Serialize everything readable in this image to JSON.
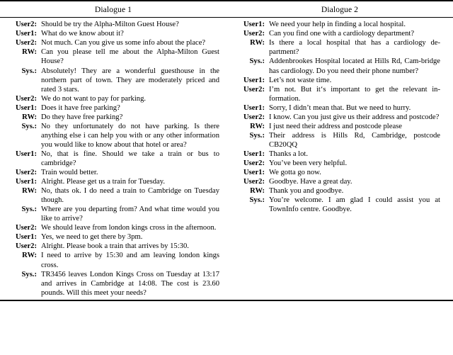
{
  "table": {
    "headers": [
      "Dialogue 1",
      "Dialogue 2"
    ],
    "dialogue_1": [
      {
        "speaker": "User2:",
        "text": "Should be try the Alpha-Milton Guest House?",
        "justify": false
      },
      {
        "speaker": "User1:",
        "text": "What do we know about it?",
        "justify": false
      },
      {
        "speaker": "User2:",
        "text": "Not much. Can you give us some info about the place?",
        "justify": true
      },
      {
        "speaker": "RW:",
        "text": "Can you please tell me about the Alpha-Milton Guest House?",
        "justify": true
      },
      {
        "speaker": "Sys.:",
        "text": "Absolutely! They are a wonderful guesthouse in the northern part of town. They are moderately priced and rated 3 stars.",
        "justify": true
      },
      {
        "speaker": "User2:",
        "text": "We do not want to pay for parking.",
        "justify": false
      },
      {
        "speaker": "User1:",
        "text": "Does it have free parking?",
        "justify": false
      },
      {
        "speaker": "RW:",
        "text": "Do they have free parking?",
        "justify": false
      },
      {
        "speaker": "Sys.:",
        "text": "No they unfortunately do not have parking. Is there anything else i can help you with or any other information you would like to know about that hotel or area?",
        "justify": true
      },
      {
        "speaker": "User1:",
        "text": "No, that is fine. Should we take a train or bus to cambridge?",
        "justify": true
      },
      {
        "speaker": "User2:",
        "text": "Train would better.",
        "justify": false
      },
      {
        "speaker": "User1:",
        "text": "Alright. Please get us a train for Tuesday.",
        "justify": false
      },
      {
        "speaker": "RW:",
        "text": "No, thats ok. I do need a train to Cambridge on Tuesday though.",
        "justify": true
      },
      {
        "speaker": "Sys.:",
        "text": "Where are you departing from? And what time would you like to arrive?",
        "justify": true
      },
      {
        "speaker": "User2:",
        "text": "We should leave from london kings cross in the afternoon.",
        "justify": true
      },
      {
        "speaker": "User1:",
        "text": "Yes, we need to get there by 3pm.",
        "justify": false
      },
      {
        "speaker": "User2:",
        "text": "Alright. Please book a train that arrives by 15:30.",
        "justify": false
      },
      {
        "speaker": "RW:",
        "text": "I need to arrive by 15:30 and am leaving london kings cross.",
        "justify": true
      },
      {
        "speaker": "Sys.:",
        "text": "TR3456 leaves London Kings Cross on Tuesday at 13:17 and arrives in Cambridge at 14:08. The cost is 23.60 pounds. Will this meet your needs?",
        "justify": true
      }
    ],
    "dialogue_2": [
      {
        "speaker": "User1:",
        "text": "We need your help in finding a local hospital.",
        "justify": false
      },
      {
        "speaker": "User2:",
        "text": "Can you find one with a cardiology department?",
        "justify": false
      },
      {
        "speaker": "RW:",
        "text": "Is there a local hospital that has a cardiology de-partment?",
        "justify": true
      },
      {
        "speaker": "Sys.:",
        "text": "Addenbrookes Hospital located at Hills Rd, Cam-bridge has cardiology. Do you need their phone number?",
        "justify": true
      },
      {
        "speaker": "User1:",
        "text": "Let’s not waste time.",
        "justify": false
      },
      {
        "speaker": "User2:",
        "text": "I’m not. But it‘s important to get the relevant in-formation.",
        "justify": true
      },
      {
        "speaker": "User1:",
        "text": "Sorry, I didn’t mean that. But we need to hurry.",
        "justify": false
      },
      {
        "speaker": "User2:",
        "text": "I know. Can you just give us their address and postcode?",
        "justify": true
      },
      {
        "speaker": "RW:",
        "text": "I just need their address and postcode please",
        "justify": false
      },
      {
        "speaker": "Sys.:",
        "text": "Their address is Hills Rd, Cambridge, postcode CB20QQ",
        "justify": true
      },
      {
        "speaker": "User1:",
        "text": "Thanks a lot.",
        "justify": false
      },
      {
        "speaker": "User2:",
        "text": "You’ve been very helpful.",
        "justify": false
      },
      {
        "speaker": "User1:",
        "text": "We gotta go now.",
        "justify": false
      },
      {
        "speaker": "User2:",
        "text": "Goodbye. Have a great day.",
        "justify": false
      },
      {
        "speaker": "RW:",
        "text": "Thank you and goodbye.",
        "justify": false
      },
      {
        "speaker": "Sys.:",
        "text": "You’re welcome. I am glad I could assist you at TownInfo centre. Goodbye.",
        "justify": true
      }
    ]
  }
}
